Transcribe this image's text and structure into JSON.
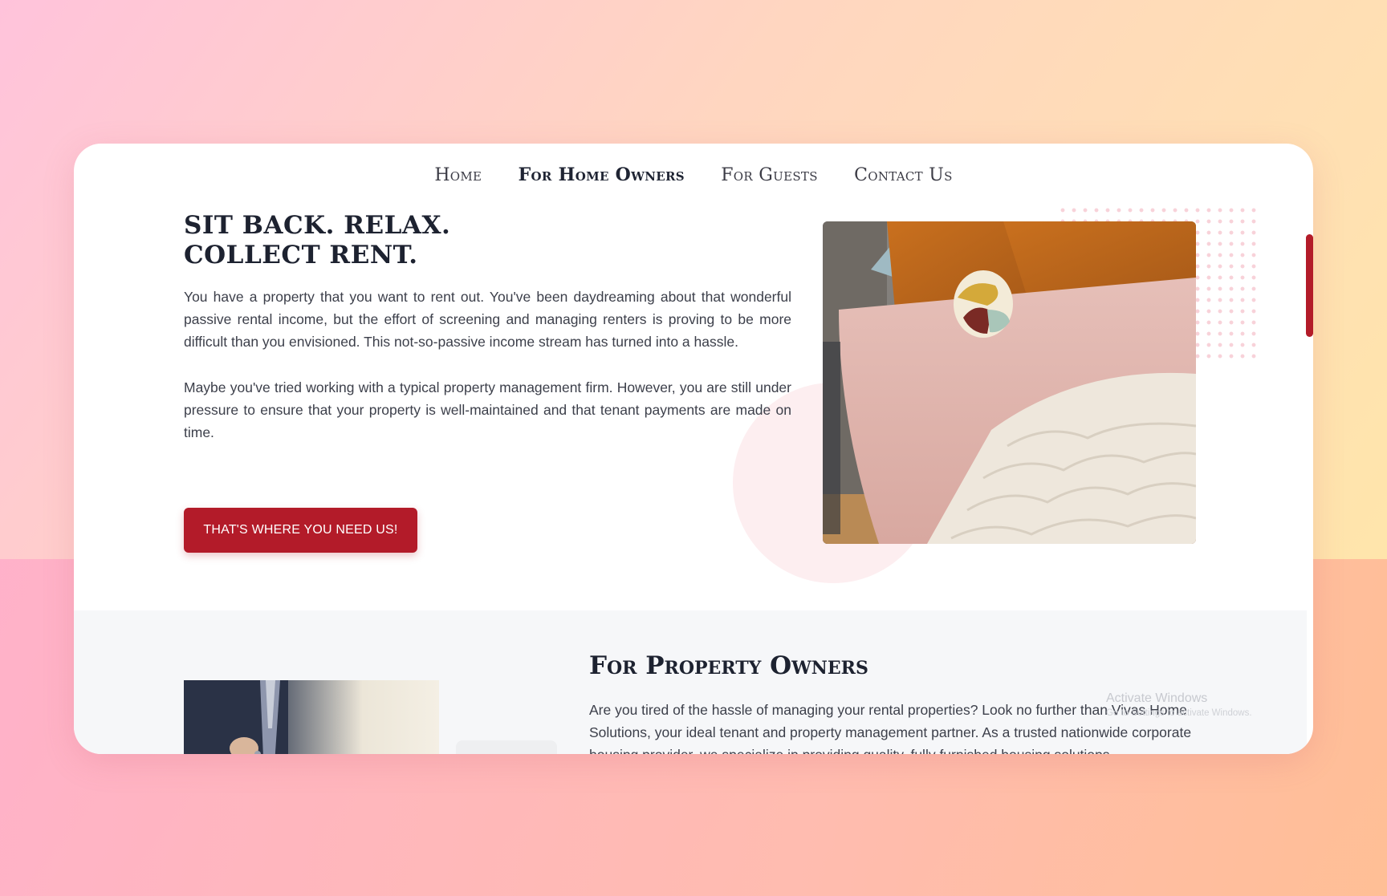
{
  "nav": {
    "items": [
      "Home",
      "For Home Owners",
      "For Guests",
      "Contact Us"
    ],
    "active": "For Home Owners"
  },
  "hero": {
    "title_line1": "SIT BACK. RELAX.",
    "title_line2": "COLLECT RENT.",
    "paragraph1": "You have a property that you want to rent out. You've been daydreaming about that wonderful passive rental income, but the effort of screening and managing renters is proving to be more difficult than you envisioned. This not-so-passive income stream has turned into a hassle.",
    "paragraph2": "Maybe you've tried working with a typical property management firm. However, you are still under pressure to ensure that your property is well-maintained and that tenant payments are made on time.",
    "cta_label": "THAT'S WHERE YOU NEED US!",
    "image_icon": "bedroom-photo"
  },
  "section2": {
    "title": "For Property Owners",
    "paragraph": "Are you tired of the hassle of managing your rental properties? Look no further than Vivas Home Solutions, your ideal tenant and property management partner. As a trusted nationwide corporate housing provider, we specialize in providing quality, fully furnished housing solutions",
    "image_icon": "businessman-handing-keys-photo"
  },
  "os_watermark": {
    "line1": "Activate Windows",
    "line2": "Go to Settings to activate Windows."
  },
  "colors": {
    "accent": "#b31b29",
    "heading": "#1d2230",
    "body_text": "#3c3f4a",
    "section_bg": "#f6f7f9"
  }
}
